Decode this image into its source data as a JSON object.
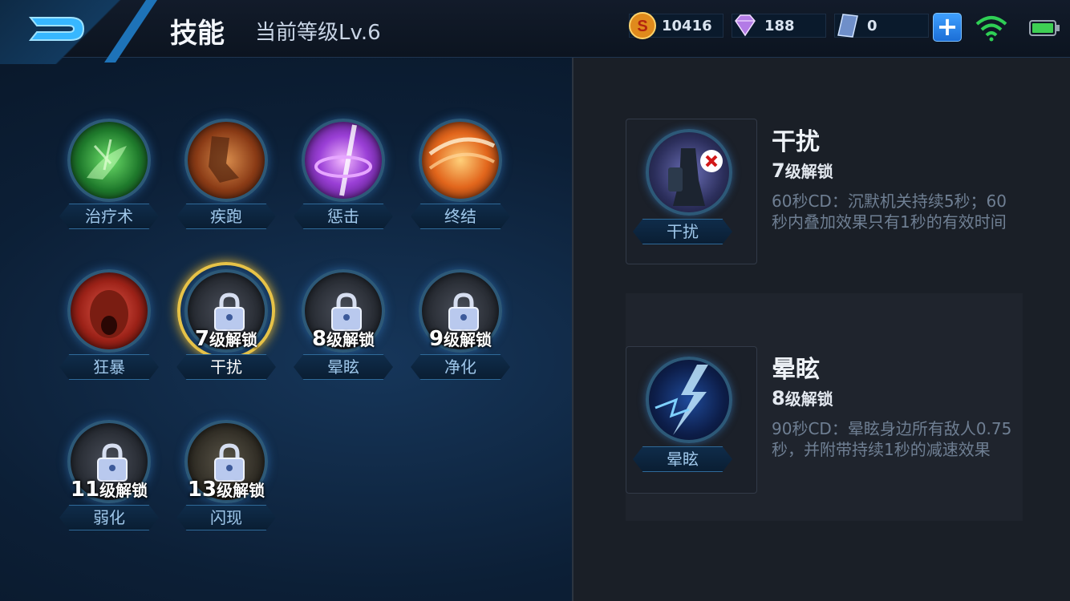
{
  "header": {
    "title": "技能",
    "level_text": "当前等级Lv.6",
    "gold": "10416",
    "diamonds": "188",
    "vouchers": "0",
    "plus": "+"
  },
  "skills": [
    {
      "name": "治疗术",
      "locked": false,
      "color": "#2e8f3e"
    },
    {
      "name": "疾跑",
      "locked": false,
      "color": "#b5551f"
    },
    {
      "name": "惩击",
      "locked": false,
      "color": "#8e35c4"
    },
    {
      "name": "终结",
      "locked": false,
      "color": "#d3661b"
    },
    {
      "name": "狂暴",
      "locked": false,
      "color": "#b4261d"
    },
    {
      "name": "干扰",
      "locked": true,
      "unlock_level": "7",
      "unlock_suffix": "级解锁",
      "selected": true
    },
    {
      "name": "晕眩",
      "locked": true,
      "unlock_level": "8",
      "unlock_suffix": "级解锁"
    },
    {
      "name": "净化",
      "locked": true,
      "unlock_level": "9",
      "unlock_suffix": "级解锁"
    },
    {
      "name": "弱化",
      "locked": true,
      "unlock_level": "11",
      "unlock_suffix": "级解锁"
    },
    {
      "name": "闪现",
      "locked": true,
      "unlock_level": "13",
      "unlock_suffix": "级解锁"
    }
  ],
  "details": [
    {
      "name": "干扰",
      "icon_label": "干扰",
      "unlock_level": "7",
      "unlock_suffix": "级解锁",
      "desc": "60秒CD：沉默机关持续5秒；60秒内叠加效果只有1秒的有效时间"
    },
    {
      "name": "晕眩",
      "icon_label": "晕眩",
      "unlock_level": "8",
      "unlock_suffix": "级解锁",
      "desc": "90秒CD：晕眩身边所有敌人0.75秒，并附带持续1秒的减速效果"
    }
  ]
}
